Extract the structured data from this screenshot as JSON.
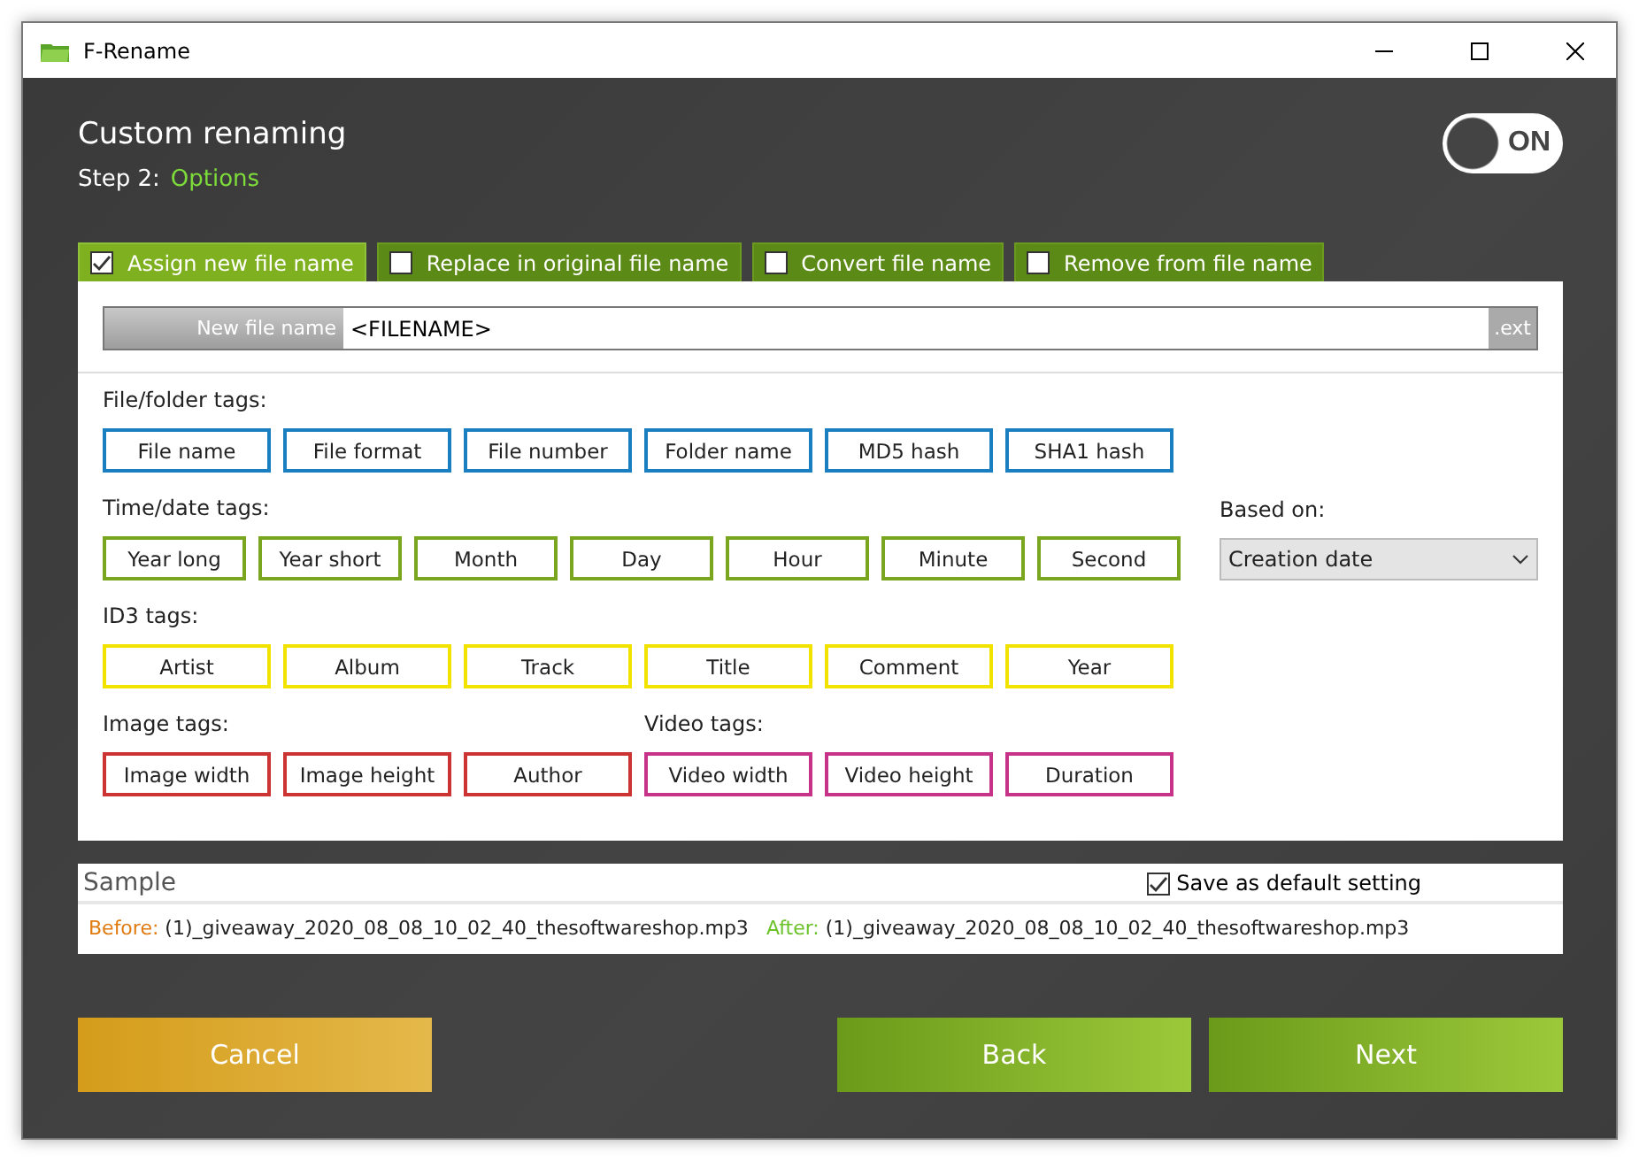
{
  "window": {
    "title": "F-Rename"
  },
  "heading": "Custom renaming",
  "step": {
    "label": "Step 2:",
    "value": "Options"
  },
  "toggle": {
    "label": "ON",
    "on": true
  },
  "tabs": [
    {
      "label": "Assign new file name",
      "checked": true,
      "selected": true
    },
    {
      "label": "Replace in original file name",
      "checked": false,
      "selected": false
    },
    {
      "label": "Convert file name",
      "checked": false,
      "selected": false
    },
    {
      "label": "Remove from file name",
      "checked": false,
      "selected": false
    }
  ],
  "new_file_name": {
    "label": "New file name",
    "value": "<FILENAME>",
    "extension": ".ext"
  },
  "tag_rows": [
    {
      "groups": [
        {
          "label": "File/folder tags:",
          "color": "#1a7fc0",
          "tags": [
            "File name",
            "File format",
            "File number",
            "Folder name",
            "MD5 hash",
            "SHA1 hash"
          ]
        }
      ]
    },
    {
      "groups": [
        {
          "label": "Time/date tags:",
          "color": "#7aa51e",
          "tags": [
            "Year long",
            "Year short",
            "Month",
            "Day",
            "Hour",
            "Minute",
            "Second"
          ]
        }
      ],
      "based_on": {
        "label": "Based on:",
        "value": "Creation date"
      }
    },
    {
      "groups": [
        {
          "label": "ID3 tags:",
          "color": "#f2e200",
          "tags": [
            "Artist",
            "Album",
            "Track",
            "Title",
            "Comment",
            "Year"
          ]
        }
      ]
    },
    {
      "groups": [
        {
          "label": "Image tags:",
          "color": "#cc3333",
          "tags": [
            "Image width",
            "Image height",
            "Author"
          ]
        },
        {
          "label": "Video tags:",
          "color": "#c8338a",
          "tags": [
            "Video width",
            "Video height",
            "Duration"
          ]
        }
      ]
    }
  ],
  "sample": {
    "title": "Sample",
    "save_default": {
      "label": "Save as default setting",
      "checked": true
    },
    "before_label": "Before:",
    "before": "(1)_giveaway_2020_08_08_10_02_40_thesoftwareshop.mp3",
    "after_label": "After:",
    "after": "(1)_giveaway_2020_08_08_10_02_40_thesoftwareshop.mp3"
  },
  "buttons": [
    {
      "label": "Cancel",
      "kind": "cancel"
    },
    {
      "label": "Back",
      "kind": "nav"
    },
    {
      "label": "Next",
      "kind": "nav"
    }
  ]
}
